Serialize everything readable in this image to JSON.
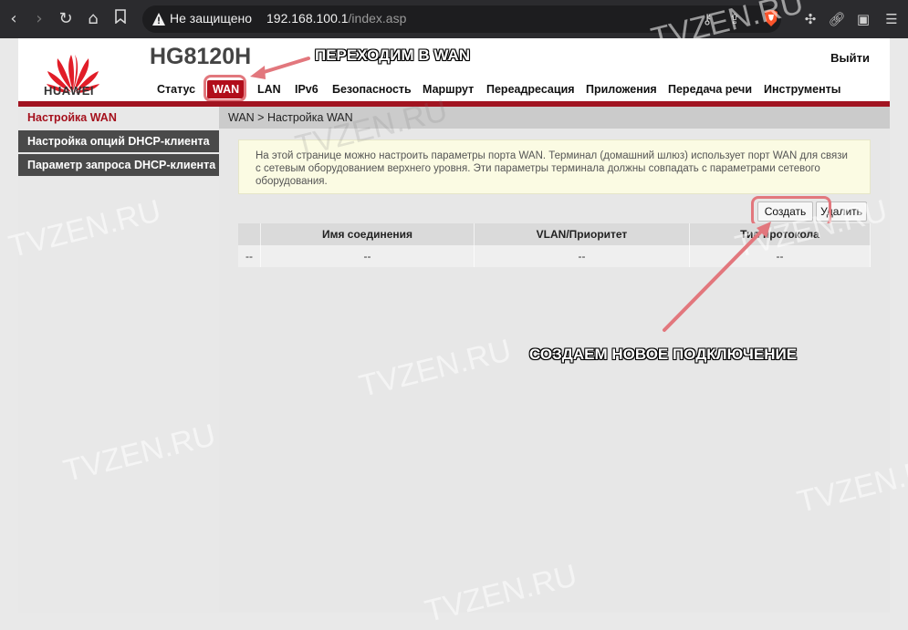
{
  "browser": {
    "security_label": "Не защищено",
    "url_host": "192.168.100.1",
    "url_path": "/index.asp",
    "icons": [
      "back-icon",
      "forward-icon",
      "reload-icon",
      "home-icon",
      "bookmark-icon",
      "warning-icon",
      "key-icon",
      "share-icon",
      "brave-shield-icon",
      "extensions-icon",
      "link-icon",
      "sidebar-icon",
      "menu-icon"
    ]
  },
  "router": {
    "brand": "HUAWEI",
    "model": "HG8120H",
    "logout": "Выйти",
    "nav": [
      "Статус",
      "WAN",
      "LAN",
      "IPv6",
      "Безопасность",
      "Маршрут",
      "Переадресация",
      "Приложения",
      "Передача речи",
      "Инструменты"
    ],
    "active_nav": "WAN",
    "brand_color": "#b10d1b"
  },
  "sidebar": {
    "items": [
      "Настройка WAN",
      "Настройка опций DHCP-клиента",
      "Параметр запроса DHCP-клиента"
    ]
  },
  "content": {
    "breadcrumb": "WAN > Настройка WAN",
    "info_text": "На этой странице можно настроить параметры порта WAN. Терминал (домашний шлюз) использует порт WAN для связи с сетевым оборудованием верхнего уровня. Эти параметры терминала должны совпадать с параметрами сетевого оборудования.",
    "create_button": "Создать",
    "delete_button": "Удалить",
    "table": {
      "headers": [
        "",
        "Имя соединения",
        "VLAN/Приоритет",
        "Тип протокола"
      ],
      "rows": [
        [
          "--",
          "--",
          "--",
          "--"
        ]
      ]
    }
  },
  "annotations": {
    "goto_wan": "ПЕРЕХОДИМ В WAN",
    "create_new": "СОЗДАЕМ НОВОЕ ПОДКЛЮЧЕНИЕ",
    "annotation_color": "#e2777d"
  },
  "watermark": "TVZEN.RU"
}
